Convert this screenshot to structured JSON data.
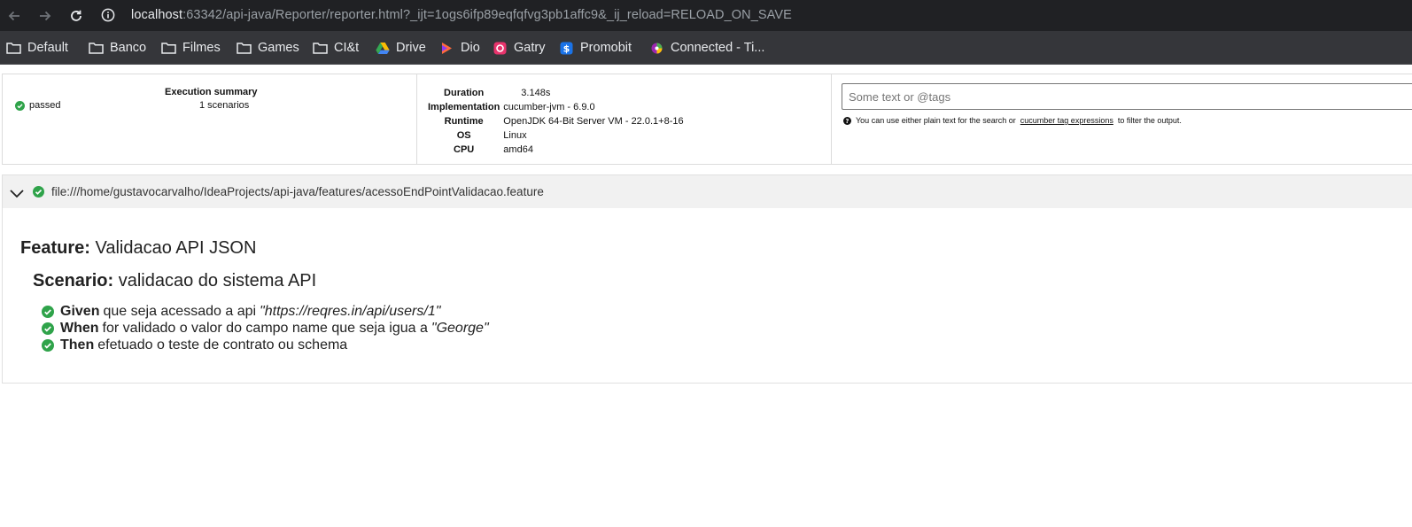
{
  "browser": {
    "url_host": "localhost",
    "url_rest": ":63342/api-java/Reporter/reporter.html?_ijt=1ogs6ifp89eqfqfvg3pb1affc9&_ij_reload=RELOAD_ON_SAVE",
    "bookmarks": [
      {
        "label": "Default",
        "icon": "folder-icon"
      },
      {
        "label": "Banco",
        "icon": "folder-icon"
      },
      {
        "label": "Filmes",
        "icon": "folder-icon"
      },
      {
        "label": "Games",
        "icon": "folder-icon"
      },
      {
        "label": "CI&t",
        "icon": "folder-icon"
      },
      {
        "label": "Drive",
        "icon": "google-drive-icon"
      },
      {
        "label": "Dio",
        "icon": "dio-icon"
      },
      {
        "label": "Gatry",
        "icon": "gatry-icon"
      },
      {
        "label": "Promobit",
        "icon": "promobit-icon"
      },
      {
        "label": "Connected - Ti...",
        "icon": "connected-icon"
      }
    ]
  },
  "summary": {
    "title": "Execution summary",
    "status": "passed",
    "scenarios": "1 scenarios"
  },
  "environment": {
    "rows": [
      {
        "key": "Duration",
        "value": "3.148s"
      },
      {
        "key": "Implementation",
        "value": "cucumber-jvm - 6.9.0"
      },
      {
        "key": "Runtime",
        "value": "OpenJDK 64-Bit Server VM - 22.0.1+8-16"
      },
      {
        "key": "OS",
        "value": "Linux"
      },
      {
        "key": "CPU",
        "value": "amd64"
      }
    ]
  },
  "search": {
    "placeholder": "Some text or @tags",
    "help_before": "You can use either plain text for the search or",
    "help_link": "cucumber tag expressions",
    "help_after": "to filter the output."
  },
  "feature": {
    "path": "file:///home/gustavocarvalho/IdeaProjects/api-java/features/acessoEndPointValidacao.feature",
    "keyword": "Feature:",
    "name": "Validacao API JSON",
    "scenario": {
      "keyword": "Scenario:",
      "name": "validacao do sistema API",
      "steps": [
        {
          "keyword": "Given",
          "text": "que seja acessado a api",
          "arg": "\"https://reqres.in/api/users/1\""
        },
        {
          "keyword": "When",
          "text": "for validado o valor do campo name que seja igua a",
          "arg": "\"George\""
        },
        {
          "keyword": "Then",
          "text": "efetuado o teste de contrato ou schema",
          "arg": ""
        }
      ]
    }
  },
  "colors": {
    "passed": "#2fa34a",
    "toolbar": "#202124",
    "bookmarks_bar": "#35363a"
  }
}
